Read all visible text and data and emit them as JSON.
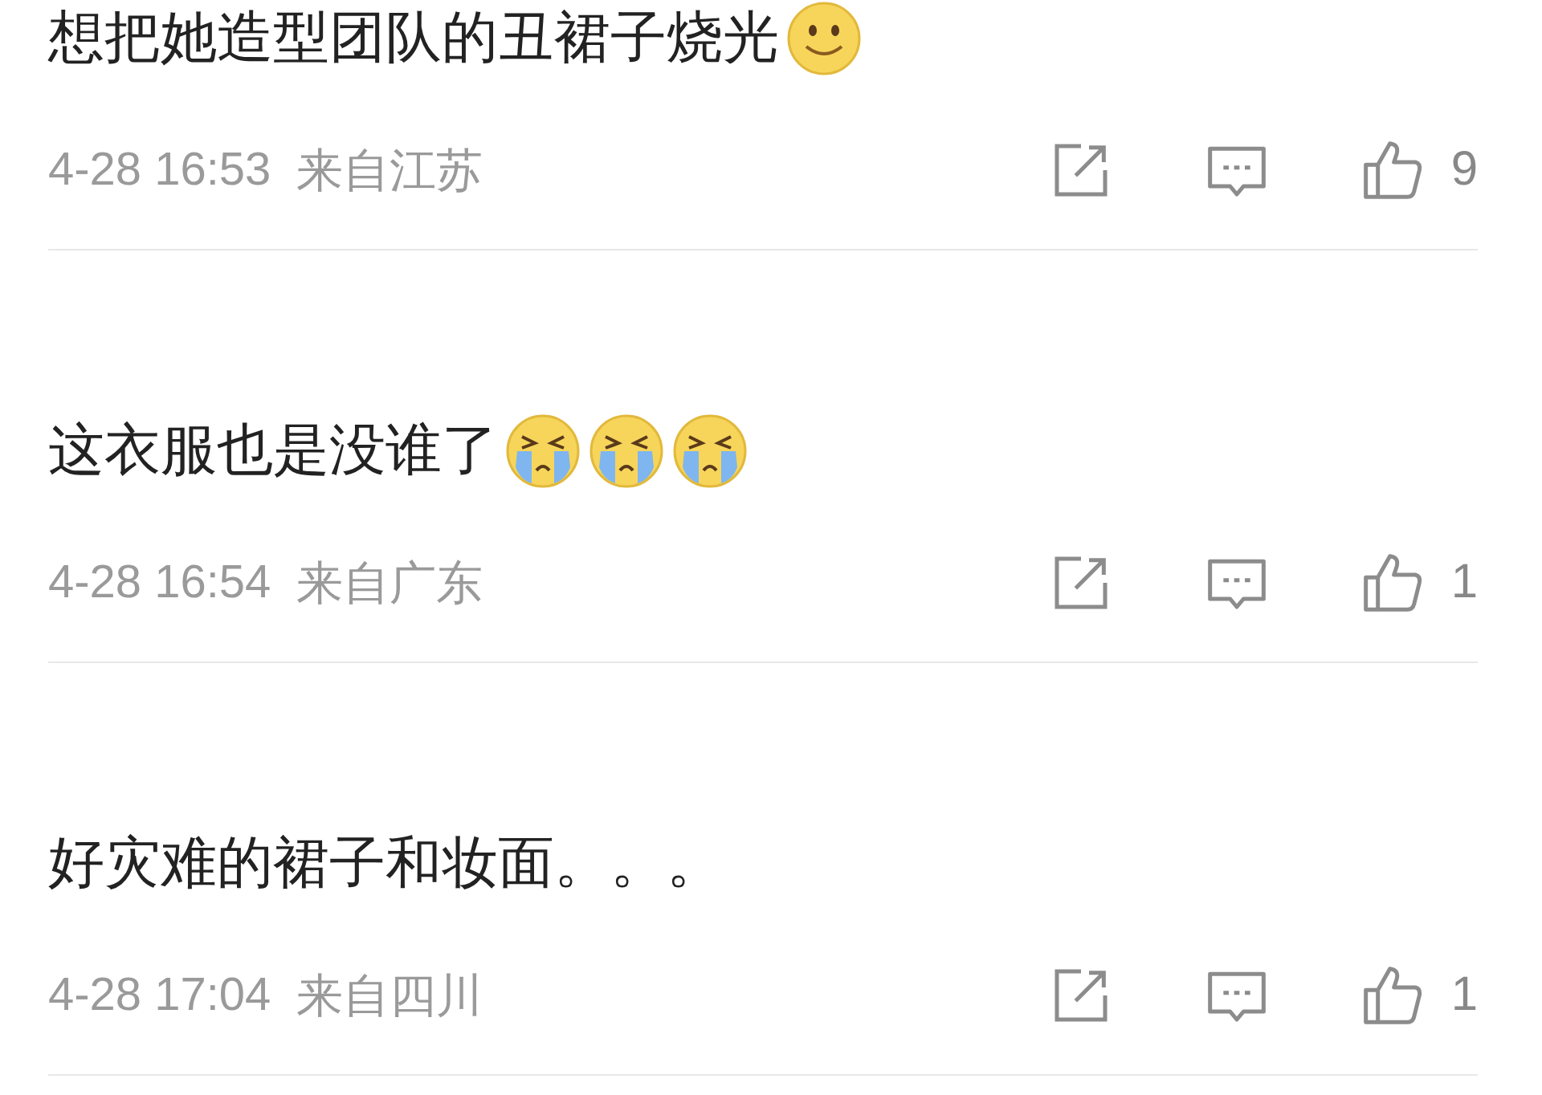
{
  "comments": [
    {
      "text": "想把她造型团队的丑裙子烧光",
      "emojis": [
        {
          "kind": "smile"
        }
      ],
      "time": "4-28 16:53",
      "location": "来自江苏",
      "likes": "9"
    },
    {
      "text": "这衣服也是没谁了",
      "emojis": [
        {
          "kind": "cry"
        },
        {
          "kind": "cry"
        },
        {
          "kind": "cry"
        }
      ],
      "time": "4-28 16:54",
      "location": "来自广东",
      "likes": "1"
    },
    {
      "text": "好灾难的裙子和妆面。。。",
      "time": "4-28 17:04",
      "location": "来自四川",
      "likes": "1"
    }
  ]
}
